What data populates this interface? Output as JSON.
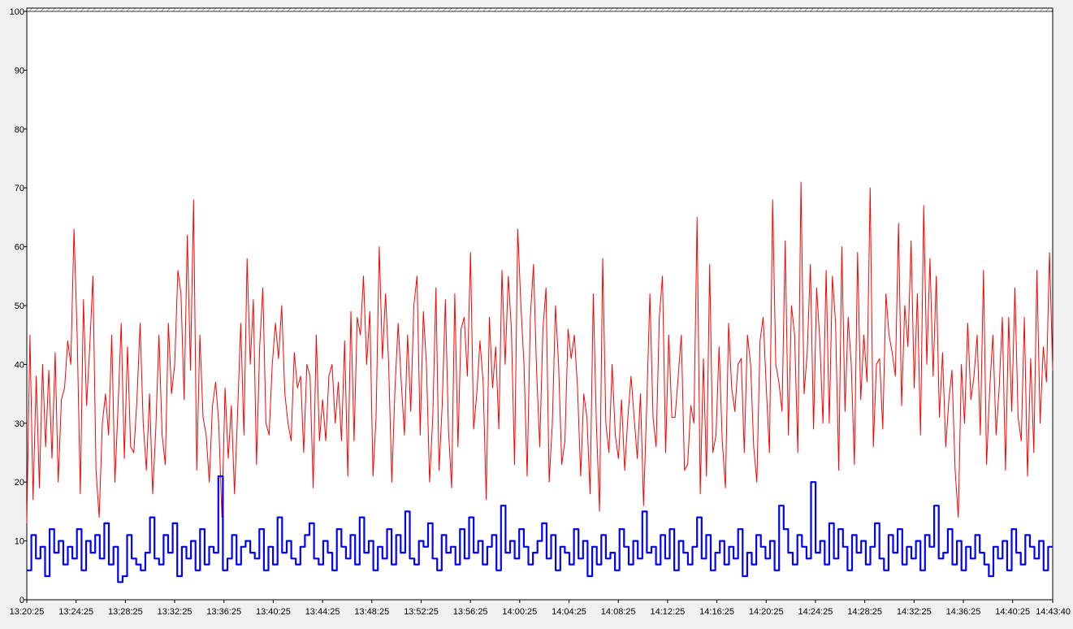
{
  "chart_data": {
    "type": "line",
    "x_start": "13:20:25",
    "x_end": "14:43:40",
    "xticks": [
      "13:20:25",
      "13:24:25",
      "13:28:25",
      "13:32:25",
      "13:36:25",
      "13:40:25",
      "13:44:25",
      "13:48:25",
      "13:52:25",
      "13:56:25",
      "14:00:25",
      "14:04:25",
      "14:08:25",
      "14:12:25",
      "14:16:25",
      "14:20:25",
      "14:24:25",
      "14:28:25",
      "14:32:25",
      "14:36:25",
      "14:40:25",
      "14:43:40"
    ],
    "yticks": [
      0,
      10,
      20,
      30,
      40,
      50,
      60,
      70,
      80,
      90,
      100
    ],
    "ylim": [
      0,
      100
    ],
    "grid": false,
    "legend": "none",
    "series": [
      {
        "color": "#ff0000",
        "stroke": "thin",
        "values": [
          13,
          45,
          17,
          38,
          19,
          40,
          26,
          39,
          24,
          42,
          20,
          34,
          36,
          44,
          40,
          63,
          45,
          18,
          51,
          33,
          43,
          55,
          22,
          14,
          30,
          35,
          28,
          45,
          20,
          33,
          47,
          24,
          43,
          26,
          25,
          34,
          47,
          30,
          22,
          35,
          18,
          29,
          45,
          28,
          23,
          47,
          35,
          40,
          56,
          52,
          34,
          62,
          39,
          68,
          22,
          45,
          31,
          28,
          20,
          33,
          37,
          30,
          14,
          36,
          24,
          33,
          18,
          32,
          47,
          28,
          58,
          40,
          51,
          23,
          43,
          53,
          30,
          28,
          40,
          47,
          41,
          50,
          35,
          30,
          27,
          42,
          36,
          38,
          25,
          40,
          38,
          19,
          45,
          27,
          34,
          27,
          38,
          40,
          30,
          37,
          27,
          44,
          21,
          49,
          27,
          48,
          45,
          55,
          40,
          49,
          21,
          31,
          60,
          41,
          52,
          40,
          20,
          36,
          47,
          37,
          28,
          45,
          32,
          50,
          55,
          28,
          49,
          40,
          20,
          31,
          53,
          22,
          33,
          51,
          29,
          19,
          52,
          26,
          46,
          48,
          38,
          59,
          29,
          35,
          44,
          37,
          17,
          48,
          36,
          43,
          29,
          56,
          40,
          55,
          46,
          23,
          63,
          50,
          40,
          21,
          48,
          57,
          39,
          26,
          46,
          53,
          20,
          30,
          50,
          40,
          23,
          27,
          46,
          41,
          45,
          36,
          21,
          35,
          31,
          18,
          52,
          30,
          15,
          58,
          30,
          25,
          40,
          28,
          24,
          34,
          22,
          31,
          38,
          31,
          24,
          35,
          16,
          33,
          52,
          31,
          26,
          48,
          55,
          25,
          45,
          31,
          31,
          38,
          45,
          22,
          23,
          33,
          30,
          65,
          18,
          41,
          21,
          57,
          25,
          28,
          43,
          27,
          19,
          47,
          36,
          32,
          40,
          41,
          25,
          45,
          40,
          26,
          20,
          44,
          48,
          36,
          25,
          68,
          40,
          37,
          32,
          61,
          28,
          50,
          45,
          25,
          71,
          35,
          42,
          57,
          29,
          53,
          44,
          30,
          56,
          30,
          55,
          47,
          22,
          60,
          32,
          48,
          40,
          23,
          59,
          34,
          45,
          37,
          70,
          26,
          40,
          41,
          29,
          52,
          45,
          42,
          38,
          64,
          33,
          50,
          43,
          61,
          36,
          52,
          28,
          67,
          40,
          58,
          38,
          55,
          31,
          42,
          26,
          34,
          39,
          22,
          14,
          40,
          30,
          47,
          34,
          38,
          45,
          28,
          56,
          23,
          36,
          45,
          28,
          36,
          48,
          22,
          48,
          32,
          53,
          31,
          27,
          48,
          21,
          41,
          25,
          56,
          30,
          43,
          37,
          59,
          39
        ]
      },
      {
        "color": "#0000ff",
        "stroke": "thick",
        "values": [
          5,
          11,
          7,
          9,
          4,
          12,
          8,
          10,
          6,
          9,
          7,
          12,
          5,
          10,
          8,
          11,
          7,
          13,
          6,
          9,
          3,
          4,
          11,
          7,
          6,
          5,
          8,
          14,
          7,
          6,
          11,
          8,
          13,
          4,
          9,
          7,
          10,
          5,
          12,
          6,
          9,
          8,
          21,
          5,
          7,
          11,
          6,
          9,
          10,
          8,
          7,
          12,
          5,
          9,
          6,
          14,
          8,
          10,
          7,
          6,
          9,
          11,
          13,
          7,
          6,
          10,
          8,
          5,
          12,
          9,
          7,
          11,
          6,
          14,
          8,
          10,
          5,
          9,
          7,
          12,
          6,
          11,
          8,
          15,
          7,
          6,
          10,
          9,
          13,
          7,
          5,
          11,
          8,
          9,
          6,
          12,
          7,
          14,
          8,
          10,
          6,
          9,
          11,
          5,
          16,
          8,
          10,
          7,
          12,
          9,
          6,
          8,
          10,
          13,
          7,
          11,
          5,
          9,
          8,
          6,
          12,
          7,
          10,
          4,
          9,
          6,
          11,
          7,
          8,
          5,
          12,
          9,
          6,
          10,
          7,
          15,
          8,
          9,
          6,
          11,
          7,
          12,
          5,
          10,
          8,
          6,
          9,
          14,
          7,
          11,
          5,
          8,
          10,
          6,
          9,
          7,
          12,
          4,
          8,
          6,
          11,
          9,
          7,
          10,
          5,
          16,
          12,
          8,
          6,
          11,
          9,
          7,
          20,
          8,
          10,
          6,
          13,
          7,
          12,
          9,
          5,
          11,
          8,
          10,
          6,
          9,
          13,
          7,
          5,
          11,
          8,
          12,
          6,
          9,
          7,
          10,
          5,
          11,
          9,
          16,
          7,
          8,
          12,
          6,
          10,
          5,
          9,
          7,
          11,
          8,
          6,
          4,
          9,
          7,
          10,
          5,
          12,
          8,
          6,
          11,
          9,
          7,
          10,
          5,
          9
        ]
      }
    ]
  }
}
